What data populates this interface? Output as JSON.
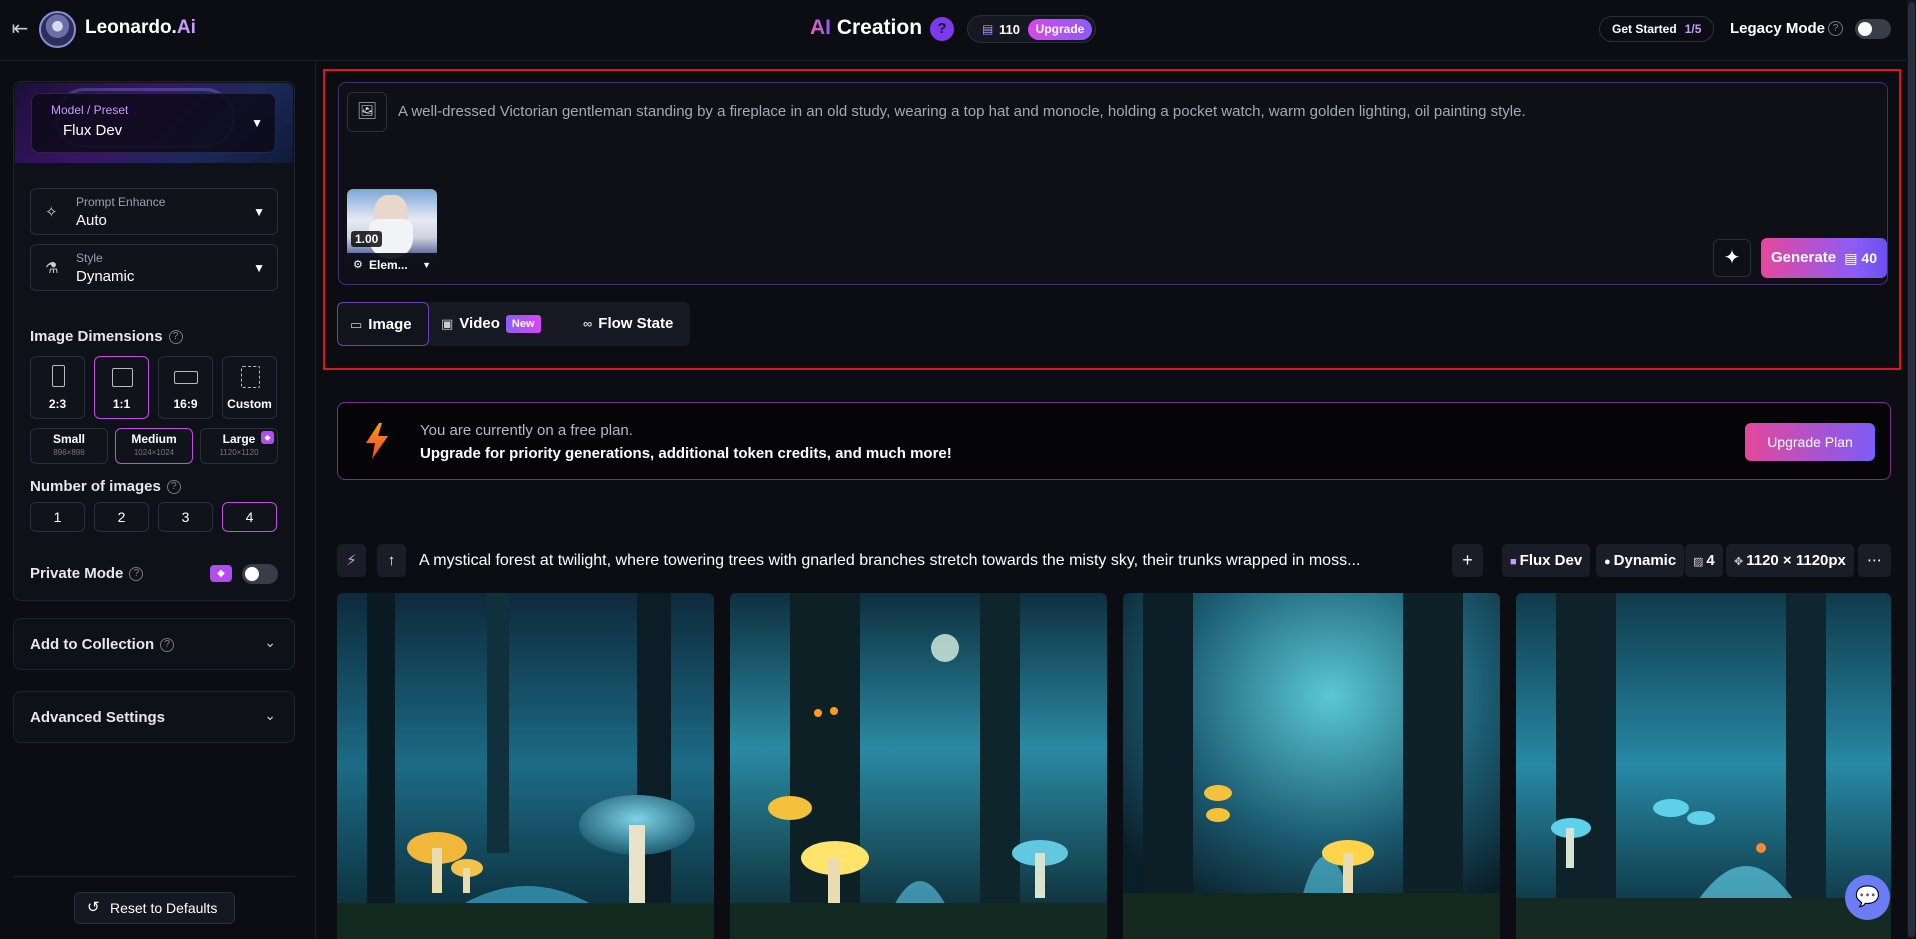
{
  "header": {
    "back_icon": "arrow-left-to-bar-icon",
    "brand": "Leonardo.",
    "brand_suffix": "Ai",
    "title_prefix": "AI",
    "title": "Creation",
    "help": "?",
    "token_count": "110",
    "upgrade_label": "Upgrade",
    "get_started": "Get Started",
    "get_started_progress": "1/5",
    "legacy_mode": "Legacy Mode",
    "legacy_help": "?"
  },
  "sidebar": {
    "model_label": "Model / Preset",
    "model_value": "Flux Dev",
    "prompt_enhance_label": "Prompt Enhance",
    "prompt_enhance_value": "Auto",
    "style_label": "Style",
    "style_value": "Dynamic",
    "image_dimensions_label": "Image Dimensions",
    "aspect_ratios": [
      "2:3",
      "1:1",
      "16:9",
      "Custom"
    ],
    "selected_aspect": "1:1",
    "sizes": [
      {
        "label": "Small",
        "res": "896×896"
      },
      {
        "label": "Medium",
        "res": "1024×1024"
      },
      {
        "label": "Large",
        "res": "1120×1120"
      }
    ],
    "selected_size": "Medium",
    "number_of_images_label": "Number of images",
    "image_counts": [
      "1",
      "2",
      "3",
      "4"
    ],
    "selected_count": "4",
    "private_mode_label": "Private Mode",
    "add_to_collection_label": "Add to Collection",
    "advanced_settings_label": "Advanced Settings",
    "reset_label": "Reset to Defaults"
  },
  "prompt": {
    "text": "A well-dressed Victorian gentleman standing by a fireplace in an old study, wearing a top hat and monocle, holding a pocket watch, warm golden lighting, oil painting style.",
    "element_weight": "1.00",
    "element_label": "Elem...",
    "generate_label": "Generate",
    "generate_cost": "40",
    "tabs": [
      {
        "label": "Image",
        "icon": "image-icon"
      },
      {
        "label": "Video",
        "icon": "video-icon",
        "badge": "New"
      },
      {
        "label": "Flow State",
        "icon": "infinity-icon"
      }
    ]
  },
  "banner": {
    "line1": "You are currently on a free plan.",
    "line2": "Upgrade for priority generations, additional token credits, and much more!",
    "button": "Upgrade Plan"
  },
  "generation": {
    "prompt": "A mystical forest at twilight, where towering trees with gnarled branches stretch towards the misty sky, their trunks wrapped in moss...",
    "model": "Flux Dev",
    "style": "Dynamic",
    "count": "4",
    "resolution": "1120 × 1120px",
    "more": "⋯"
  },
  "colors": {
    "accent": "#c04ee0",
    "highlight_border": "#e0141e",
    "generate_gradient_start": "#e5489c",
    "generate_gradient_end": "#8b5cf6"
  }
}
